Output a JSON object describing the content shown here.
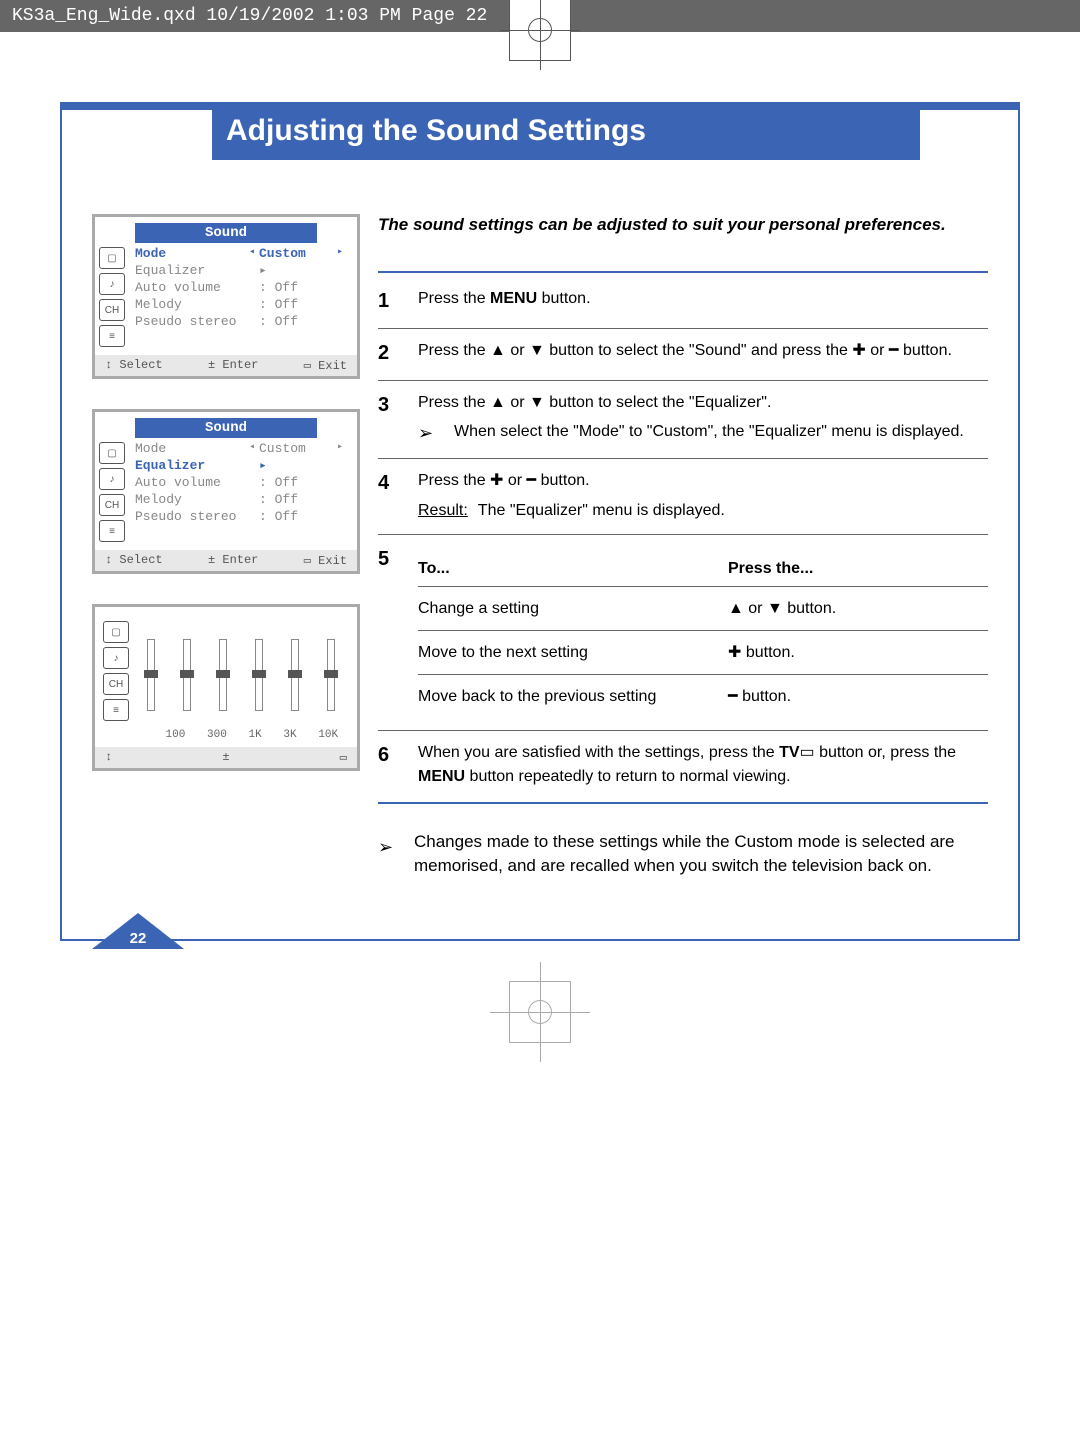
{
  "header": {
    "filename_line": "KS3a_Eng_Wide.qxd  10/19/2002  1:03 PM  Page 22"
  },
  "title": "Adjusting the Sound Settings",
  "intro": "The sound settings can be adjusted to suit your personal preferences.",
  "osd1": {
    "title": "Sound",
    "rows": [
      {
        "label": "Mode",
        "pre": "◂",
        "val": "Custom",
        "post": "▸",
        "hl": true
      },
      {
        "label": "Equalizer",
        "pre": "",
        "val": "▸",
        "post": ""
      },
      {
        "label": "Auto volume",
        "pre": "",
        "val": ": Off",
        "post": ""
      },
      {
        "label": "Melody",
        "pre": "",
        "val": ": Off",
        "post": ""
      },
      {
        "label": "Pseudo stereo",
        "pre": "",
        "val": ": Off",
        "post": ""
      }
    ],
    "footer": {
      "a": "↕ Select",
      "b": "± Enter",
      "c": "▭ Exit"
    }
  },
  "osd2": {
    "title": "Sound",
    "rows": [
      {
        "label": "Mode",
        "pre": "◂",
        "val": "Custom",
        "post": "▸"
      },
      {
        "label": "Equalizer",
        "pre": "",
        "val": "▸",
        "post": "",
        "hl": true
      },
      {
        "label": "Auto volume",
        "pre": "",
        "val": ": Off",
        "post": ""
      },
      {
        "label": "Melody",
        "pre": "",
        "val": ": Off",
        "post": ""
      },
      {
        "label": "Pseudo stereo",
        "pre": "",
        "val": ": Off",
        "post": ""
      }
    ],
    "footer": {
      "a": "↕ Select",
      "b": "± Enter",
      "c": "▭ Exit"
    }
  },
  "eq": {
    "bands": [
      "",
      "100",
      "300",
      "1K",
      "3K",
      "10K"
    ],
    "footer": {
      "a": "↕",
      "b": "±",
      "c": "▭"
    }
  },
  "steps": {
    "s1": {
      "num": "1",
      "text_a": "Press the ",
      "bold": "MENU",
      "text_b": " button."
    },
    "s2": {
      "num": "2",
      "text_a": "Press the ▲ or ▼ button to select the \"Sound\" and press the ✚ or ━ button."
    },
    "s3": {
      "num": "3",
      "line1": "Press the ▲ or ▼ button to select the \"Equalizer\".",
      "sub": "When select the \"Mode\" to \"Custom\", the \"Equalizer\" menu is displayed."
    },
    "s4": {
      "num": "4",
      "line1": "Press the ✚ or ━ button.",
      "result_label": "Result:",
      "result": "The \"Equalizer\" menu is displayed."
    },
    "s5": {
      "num": "5",
      "head_to": "To...",
      "head_press": "Press the...",
      "r1_to": "Change a setting",
      "r1_press": "▲ or ▼ button.",
      "r2_to": "Move to the next setting",
      "r2_press": "✚ button.",
      "r3_to": "Move back to the previous setting",
      "r3_press": "━ button."
    },
    "s6": {
      "num": "6",
      "text_a": "When you are satisfied with the settings, press the ",
      "bold": "TV",
      "text_b": "▭  button or, press the ",
      "bold2": "MENU",
      "text_c": " button repeatedly to return to normal viewing."
    }
  },
  "note": "Changes made to these settings while the Custom mode is selected are memorised, and are recalled when you switch the television back on.",
  "page_number": "22"
}
